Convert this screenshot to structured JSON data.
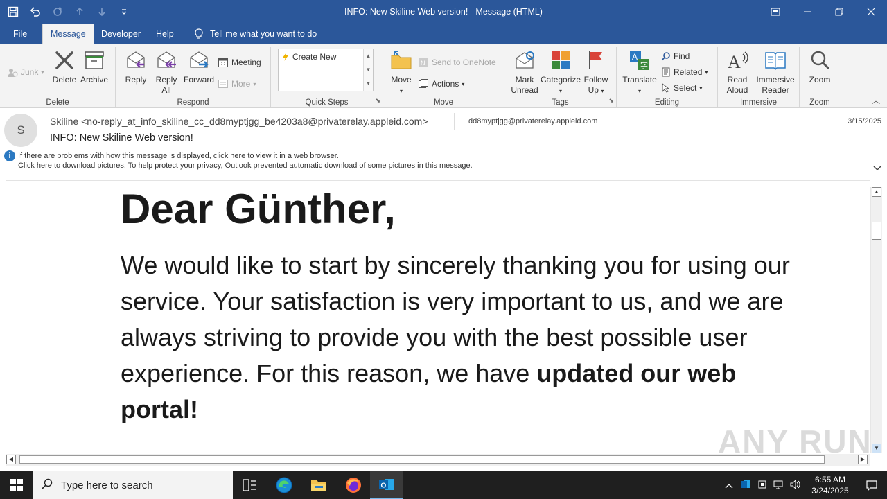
{
  "window": {
    "title": "INFO: New Skiline Web version!  -  Message (HTML)"
  },
  "tabs": [
    {
      "label": "File"
    },
    {
      "label": "Message"
    },
    {
      "label": "Developer"
    },
    {
      "label": "Help"
    },
    {
      "label": "Tell me what you want to do"
    }
  ],
  "ribbon": {
    "delete_group": {
      "label": "Delete",
      "junk": "Junk",
      "delete": "Delete",
      "archive": "Archive"
    },
    "respond_group": {
      "label": "Respond",
      "reply": "Reply",
      "reply_all": "Reply All",
      "forward": "Forward",
      "meeting": "Meeting",
      "more": "More"
    },
    "quicksteps_group": {
      "label": "Quick Steps",
      "create_new": "Create New"
    },
    "move_group": {
      "label": "Move",
      "move": "Move",
      "send_onenote": "Send to OneNote",
      "actions": "Actions"
    },
    "tags_group": {
      "label": "Tags",
      "mark_unread": "Mark Unread",
      "categorize": "Categorize",
      "follow_up": "Follow Up"
    },
    "editing_group": {
      "label": "Editing",
      "translate": "Translate",
      "find": "Find",
      "related": "Related",
      "select": "Select"
    },
    "immersive_group": {
      "label": "Immersive",
      "read_aloud": "Read Aloud",
      "immersive_reader": "Immersive Reader"
    },
    "zoom_group": {
      "label": "Zoom",
      "zoom": "Zoom"
    }
  },
  "message": {
    "avatar_initial": "S",
    "from": "Skiline <no-reply_at_info_skiline_cc_dd8myptjgg_be4203a8@privaterelay.appleid.com>",
    "to": "dd8myptjgg@privaterelay.appleid.com",
    "date": "3/15/2025",
    "subject": "INFO: New Skiline Web version!",
    "info_line1": "If there are problems with how this message is displayed, click here to view it in a web browser.",
    "info_line2": "Click here to download pictures. To help protect your privacy, Outlook prevented automatic download of some pictures in this message."
  },
  "email_body": {
    "greeting": "Dear Günther,",
    "paragraph": "We would like to start by sincerely thanking you for using our service. Your satisfaction is very important to us, and we are always striving to provide you with the best possible user experience. For this reason, we have ",
    "paragraph_bold": "updated our web portal!"
  },
  "watermark": "ANY RUN",
  "taskbar": {
    "search_placeholder": "Type here to search",
    "time": "6:55 AM",
    "date": "3/24/2025"
  },
  "colors": {
    "office_blue": "#2b579a",
    "ribbon_bg": "#f3f3f3",
    "taskbar_bg": "#1f1f1f"
  }
}
